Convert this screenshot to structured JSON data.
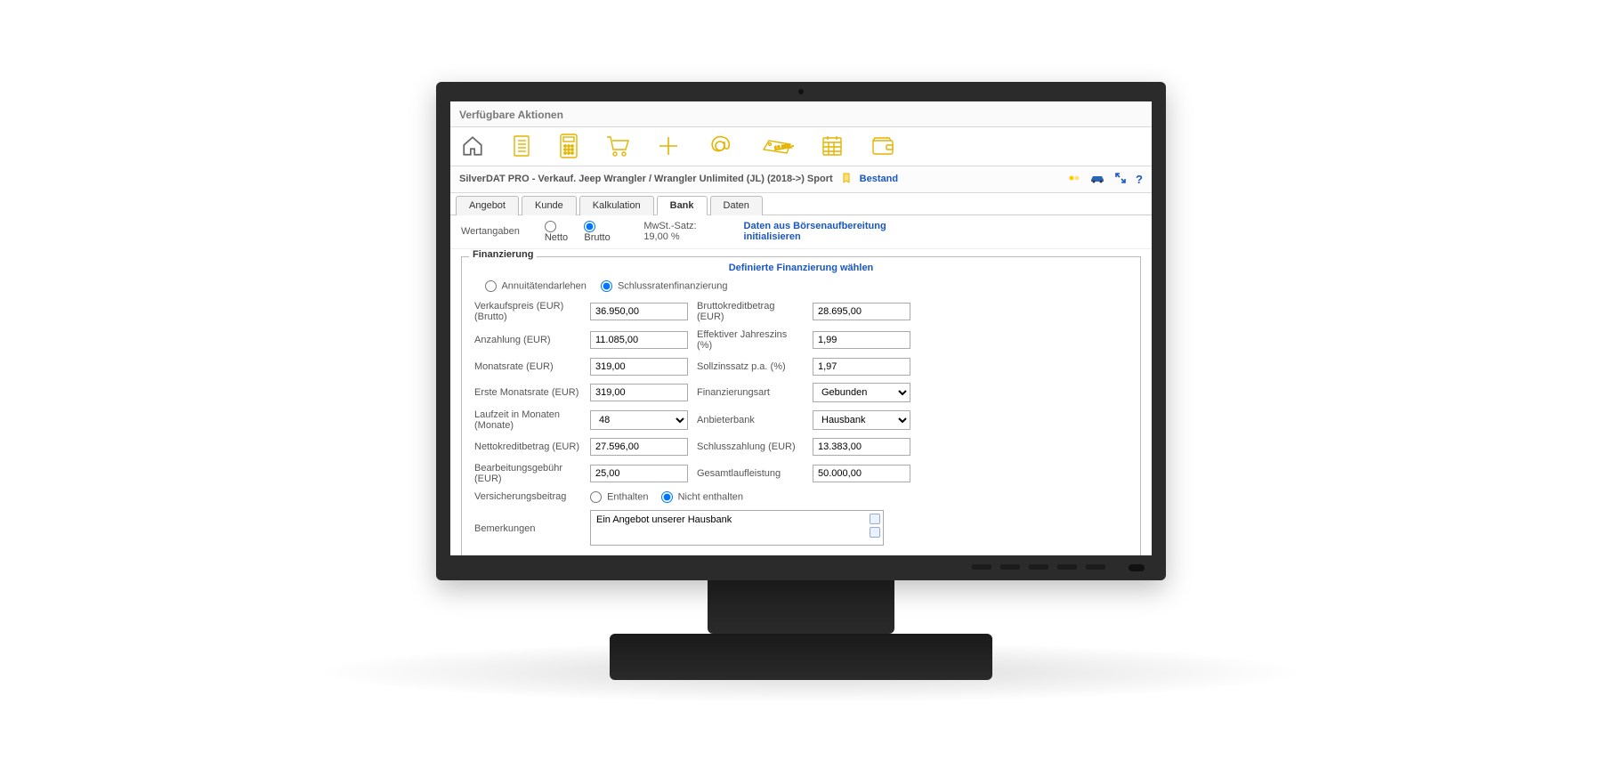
{
  "titlebar": {
    "label": "Verfügbare Aktionen"
  },
  "toolbar_icons": [
    "home",
    "list",
    "calculator",
    "cart",
    "plus",
    "at",
    "price-tag",
    "calendar",
    "wallet"
  ],
  "breadcrumb": {
    "title": "SilverDAT PRO - Verkauf. Jeep Wrangler / Wrangler Unlimited (JL) (2018->) Sport",
    "bestand_label": "Bestand"
  },
  "tabs": [
    {
      "id": "angebot",
      "label": "Angebot",
      "active": false
    },
    {
      "id": "kunde",
      "label": "Kunde",
      "active": false
    },
    {
      "id": "kalkulation",
      "label": "Kalkulation",
      "active": false
    },
    {
      "id": "bank",
      "label": "Bank",
      "active": true
    },
    {
      "id": "daten",
      "label": "Daten",
      "active": false
    }
  ],
  "controls": {
    "wertangaben_label": "Wertangaben",
    "netto_label": "Netto",
    "brutto_label": "Brutto",
    "mwst_label": "MwSt.-Satz: 19,00 %",
    "init_link": "Daten aus Börsenaufbereitung initialisieren"
  },
  "panel": {
    "title": "Finanzierung",
    "choose_link": "Definierte Finanzierung wählen",
    "type": {
      "annuitaet_label": "Annuitätendarlehen",
      "schlussraten_label": "Schlussratenfinanzierung"
    },
    "fields": {
      "verkaufspreis_label": "Verkaufspreis (EUR) (Brutto)",
      "verkaufspreis_value": "36.950,00",
      "bruttokredit_label": "Bruttokreditbetrag (EUR)",
      "bruttokredit_value": "28.695,00",
      "anzahlung_label": "Anzahlung (EUR)",
      "anzahlung_value": "11.085,00",
      "effjz_label": "Effektiver Jahreszins (%)",
      "effjz_value": "1,99",
      "monatsrate_label": "Monatsrate (EUR)",
      "monatsrate_value": "319,00",
      "sollzins_label": "Sollzinssatz p.a. (%)",
      "sollzins_value": "1,97",
      "erste_monatsrate_label": "Erste Monatsrate (EUR)",
      "erste_monatsrate_value": "319,00",
      "finanzierungsart_label": "Finanzierungsart",
      "finanzierungsart_value": "Gebunden",
      "laufzeit_label": "Laufzeit in Monaten (Monate)",
      "laufzeit_value": "48",
      "anbieterbank_label": "Anbieterbank",
      "anbieterbank_value": "Hausbank",
      "nettokredit_label": "Nettokreditbetrag (EUR)",
      "nettokredit_value": "27.596,00",
      "schlusszahlung_label": "Schlusszahlung (EUR)",
      "schlusszahlung_value": "13.383,00",
      "bearbeitungsgebuehr_label": "Bearbeitungsgebühr (EUR)",
      "bearbeitungsgebuehr_value": "25,00",
      "gesamtlaufleistung_label": "Gesamtlaufleistung",
      "gesamtlaufleistung_value": "50.000,00",
      "versicherungsbeitrag_label": "Versicherungsbeitrag",
      "enthalten_label": "Enthalten",
      "nicht_enthalten_label": "Nicht enthalten",
      "bemerkungen_label": "Bemerkungen",
      "bemerkungen_value": "Ein Angebot unserer Hausbank"
    }
  },
  "colors": {
    "accent": "#e4b400",
    "link": "#1a56c4"
  }
}
